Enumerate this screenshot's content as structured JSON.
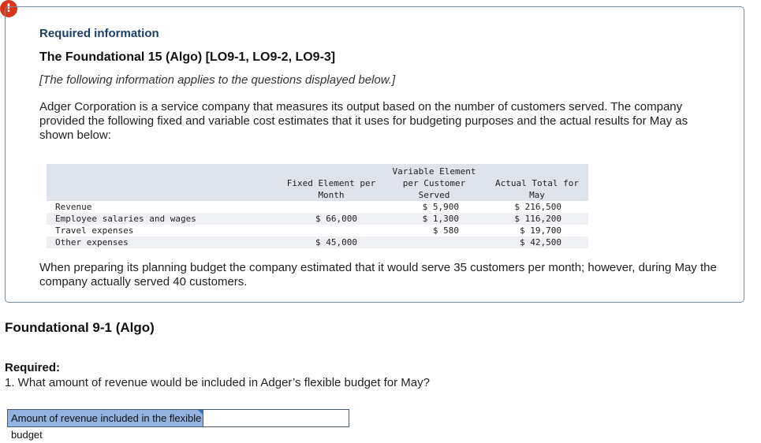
{
  "alert": {
    "symbol": "!"
  },
  "info": {
    "required_information": "Required information",
    "title": "The Foundational 15 (Algo) [LO9-1, LO9-2, LO9-3]",
    "note": "[The following information applies to the questions displayed below.]",
    "description": "Adger Corporation is a service company that measures its output based on the number of customers served. The company provided the following fixed and variable cost estimates that it uses for budgeting purposes and the actual results for May as shown below:",
    "planning": "When preparing its planning budget the company estimated that it would serve 35 customers per month; however, during May the company actually served 40 customers."
  },
  "table": {
    "headers": {
      "fixed": [
        "Fixed Element per",
        "Month"
      ],
      "variable": [
        "Variable Element",
        "per Customer",
        "Served"
      ],
      "actual": [
        "Actual Total for",
        "May"
      ]
    },
    "rows": [
      {
        "label": "Revenue",
        "fixed": "",
        "variable": "$ 5,900",
        "actual": "$ 216,500"
      },
      {
        "label": "Employee salaries and wages",
        "fixed": "$ 66,000",
        "variable": "$ 1,300",
        "actual": "$ 116,200"
      },
      {
        "label": "Travel expenses",
        "fixed": "",
        "variable": "$ 580",
        "actual": "$ 19,700"
      },
      {
        "label": "Other expenses",
        "fixed": "$ 45,000",
        "variable": "",
        "actual": "$ 42,500"
      }
    ]
  },
  "question_section": {
    "title": "Foundational 9-1 (Algo)",
    "required_label": "Required:",
    "question": "1. What amount of revenue would be included in Adger’s flexible budget for May?",
    "answer_label": "Amount of revenue included in the flexible budget",
    "answer_value": ""
  }
}
